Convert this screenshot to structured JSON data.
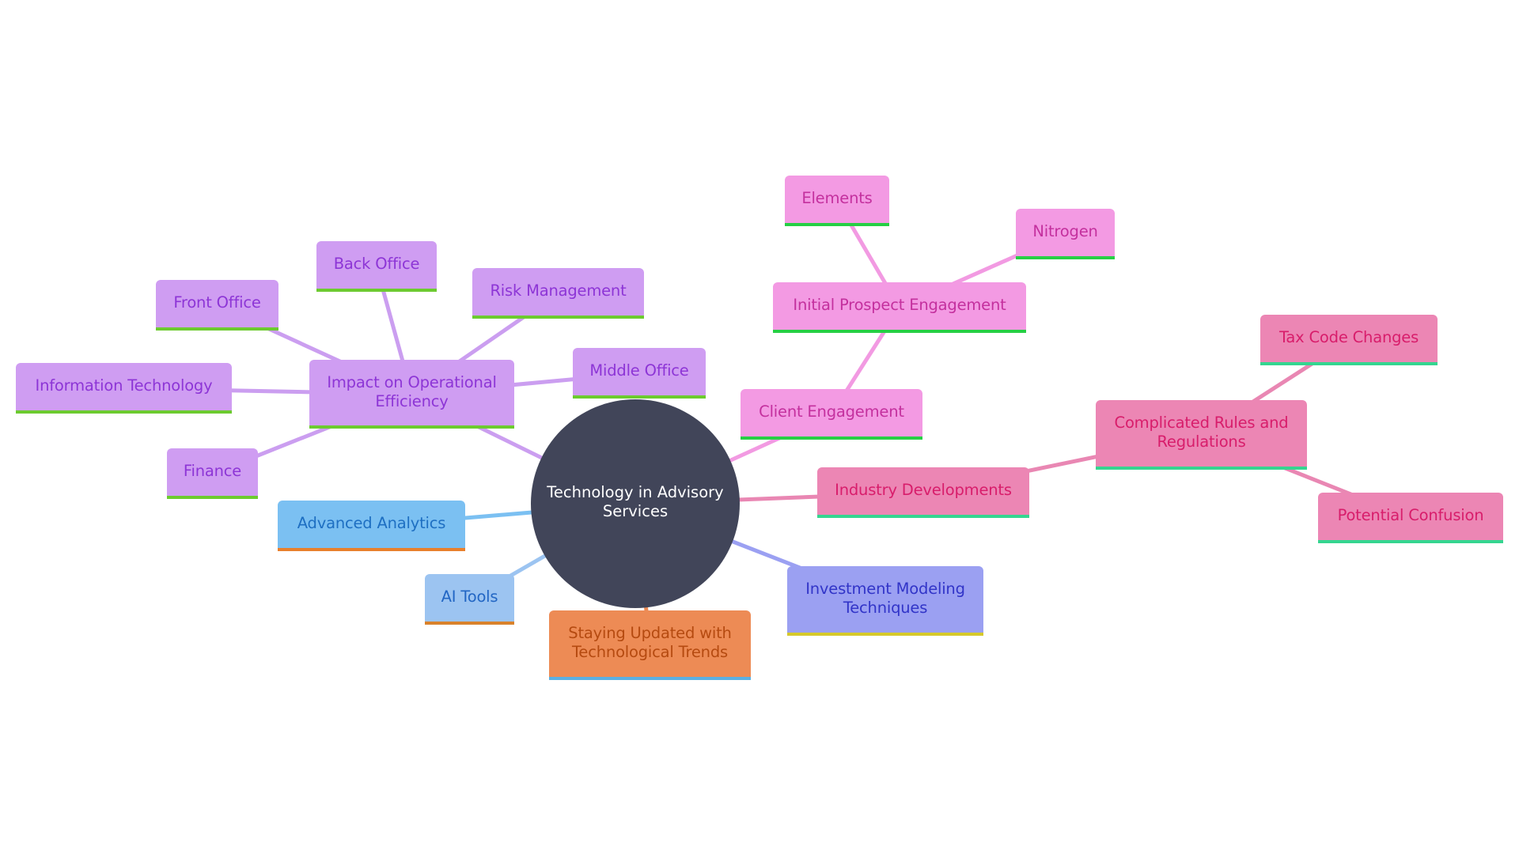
{
  "diagram": {
    "type": "mindmap",
    "root": {
      "id": "root",
      "label": "Technology in Advisory Services",
      "label_lines": "Technology in Advisory\nServices",
      "colors": {
        "bg": "#414559",
        "fg": "#ffffff"
      }
    },
    "branches": {
      "operational": {
        "colors": {
          "bg": "#cf9df2",
          "fg": "#8d35d6",
          "border": "#6ccb2f",
          "edge": "#cb9ef0"
        },
        "node": {
          "id": "impact",
          "label": "Impact on Operational\nEfficiency"
        },
        "children": [
          {
            "id": "front-office",
            "label": "Front Office"
          },
          {
            "id": "back-office",
            "label": "Back Office"
          },
          {
            "id": "risk-management",
            "label": "Risk Management"
          },
          {
            "id": "middle-office",
            "label": "Middle Office"
          },
          {
            "id": "information-technology",
            "label": "Information Technology"
          },
          {
            "id": "finance",
            "label": "Finance"
          }
        ]
      },
      "client": {
        "colors": {
          "bg": "#f39ae3",
          "fg": "#c4309e",
          "border": "#26cf44",
          "edge": "#f29ae2"
        },
        "node": {
          "id": "client-engagement",
          "label": "Client Engagement"
        },
        "sub": {
          "id": "initial-prospect",
          "label": "Initial Prospect Engagement"
        },
        "children": [
          {
            "id": "elements",
            "label": "Elements"
          },
          {
            "id": "nitrogen",
            "label": "Nitrogen"
          }
        ]
      },
      "industry": {
        "colors": {
          "bg": "#ec86b4",
          "fg": "#d81d6b",
          "border": "#35d590",
          "edge": "#e987b3"
        },
        "node": {
          "id": "industry-developments",
          "label": "Industry Developments"
        },
        "sub": {
          "id": "complicated-rules",
          "label": "Complicated Rules and\nRegulations"
        },
        "children": [
          {
            "id": "tax-code-changes",
            "label": "Tax Code Changes"
          },
          {
            "id": "potential-confusion",
            "label": "Potential Confusion"
          }
        ]
      },
      "investment": {
        "colors": {
          "bg": "#9ba0f2",
          "fg": "#3134c8",
          "border": "#d6c92a",
          "edge": "#9ba0f2"
        },
        "node": {
          "id": "investment-modeling",
          "label": "Investment Modeling\nTechniques"
        }
      },
      "trends": {
        "colors": {
          "bg": "#ed8b55",
          "fg": "#b54a10",
          "border": "#5bb0e3",
          "edge": "#ed8b55"
        },
        "node": {
          "id": "staying-updated",
          "label": "Staying Updated with\nTechnological Trends"
        }
      },
      "analytics": {
        "colors": {
          "bg": "#7bc0f2",
          "fg": "#1e6fc2",
          "border": "#e8802d",
          "edge": "#7bc0f2"
        },
        "node": {
          "id": "advanced-analytics",
          "label": "Advanced Analytics"
        }
      },
      "ai": {
        "colors": {
          "bg": "#9cc4f1",
          "fg": "#2266c4",
          "border": "#d9822b",
          "edge": "#9cc4f1"
        },
        "node": {
          "id": "ai-tools",
          "label": "AI Tools"
        }
      }
    }
  }
}
